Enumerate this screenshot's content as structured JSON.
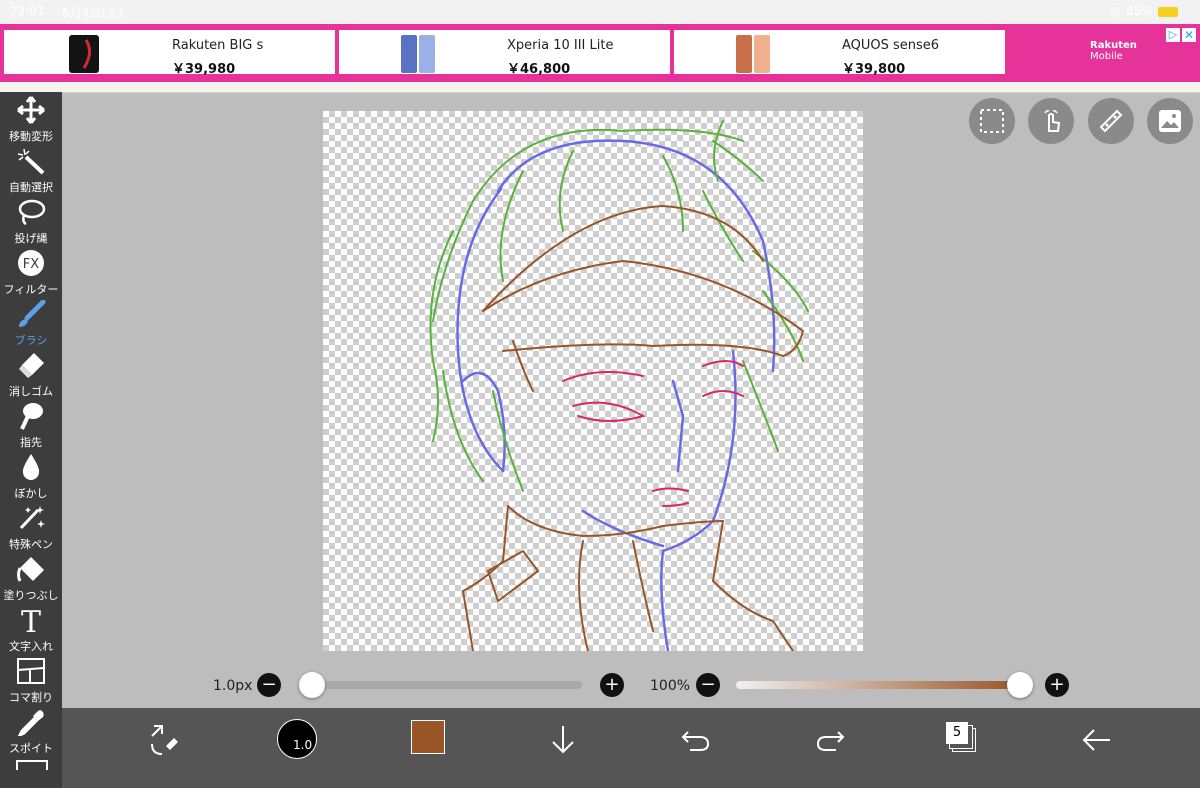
{
  "status": {
    "time": "22:01",
    "date": "6月4日(土)",
    "battery": "85%"
  },
  "ads": [
    {
      "name": "Rakuten BIG s",
      "price": "￥39,980",
      "color": "#141414"
    },
    {
      "name": "Xperia 10 III Lite",
      "price": "￥46,800",
      "color": "#7e9ad8"
    },
    {
      "name": "AQUOS sense6",
      "price": "￥39,800",
      "color": "#e8a27a"
    }
  ],
  "ad_brand": {
    "line1": "Rakuten",
    "line2": "Mobile"
  },
  "tools": [
    {
      "label": "移動変形",
      "icon": "move-icon"
    },
    {
      "label": "自動選択",
      "icon": "magic-wand-icon"
    },
    {
      "label": "投げ縄",
      "icon": "lasso-icon"
    },
    {
      "label": "フィルター",
      "icon": "fx-icon"
    },
    {
      "label": "ブラシ",
      "icon": "brush-icon",
      "active": true
    },
    {
      "label": "消しゴム",
      "icon": "eraser-icon"
    },
    {
      "label": "指先",
      "icon": "finger-icon"
    },
    {
      "label": "ぼかし",
      "icon": "blur-drop-icon"
    },
    {
      "label": "特殊ペン",
      "icon": "special-pen-icon"
    },
    {
      "label": "塗りつぶし",
      "icon": "fill-bucket-icon"
    },
    {
      "label": "文字入れ",
      "icon": "text-icon"
    },
    {
      "label": "コマ割り",
      "icon": "frame-divider-icon"
    },
    {
      "label": "スポイト",
      "icon": "eyedropper-icon"
    }
  ],
  "controls": {
    "brush_size": "1.0px",
    "brush_size_level": 0.0,
    "opacity": "100%",
    "opacity_level": 1.0
  },
  "bottom": {
    "brush_size_badge": "1.0",
    "layer_count": "5",
    "color": "#9a5527"
  },
  "colors": {
    "accent": "#5aa0e6",
    "ad_pink": "#e63399",
    "brush_color": "#9a5527"
  }
}
